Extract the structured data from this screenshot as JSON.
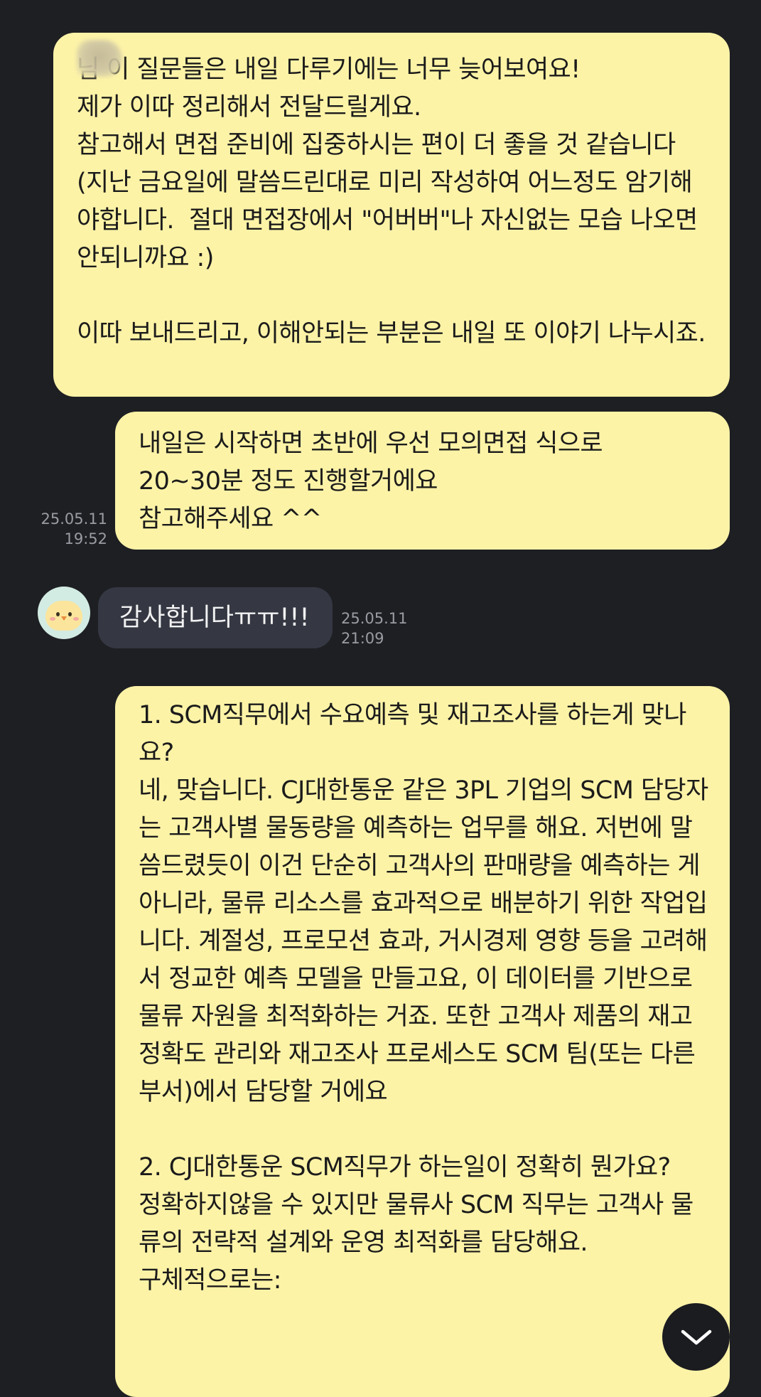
{
  "messages": [
    {
      "direction": "outgoing",
      "text": "님 이 질문들은 내일 다루기에는 너무 늦어보여요!\n제가 이따 정리해서 전달드릴게요.\n참고해서 면접 준비에 집중하시는 편이 더 좋을 것 같습니다 (지난 금요일에 말씀드린대로 미리 작성하여 어느정도 암기해야합니다.  절대 면접장에서 \"어버버\"나 자신없는 모습 나오면 안되니까요 :)\n\n이따 보내드리고, 이해안되는 부분은 내일 또 이야기 나누시죠."
    },
    {
      "direction": "outgoing",
      "text": "내일은 시작하면 초반에 우선 모의면접 식으로\n20~30분 정도 진행할거에요\n참고해주세요 ^^",
      "date": "25.05.11",
      "time": "19:52"
    },
    {
      "direction": "incoming",
      "text": "감사합니다ㅠㅠ!!!",
      "date": "25.05.11",
      "time": "21:09"
    },
    {
      "direction": "outgoing",
      "text": "1. SCM직무에서 수요예측 및 재고조사를 하는게 맞나요?\n네, 맞습니다. CJ대한통운 같은 3PL 기업의 SCM 담당자는 고객사별 물동량을 예측하는 업무를 해요. 저번에 말씀드렸듯이 이건 단순히 고객사의 판매량을 예측하는 게 아니라, 물류 리소스를 효과적으로 배분하기 위한 작업입니다. 계절성, 프로모션 효과, 거시경제 영향 등을 고려해서 정교한 예측 모델을 만들고요, 이 데이터를 기반으로 물류 자원을 최적화하는 거죠. 또한 고객사 제품의 재고 정확도 관리와 재고조사 프로세스도 SCM 팀(또는 다른 부서)에서 담당할 거에요\n\n2. CJ대한통운 SCM직무가 하는일이 정확히 뭔가요?\n정확하지않을 수 있지만 물류사 SCM 직무는 고객사 물류의 전략적 설계와 운영 최적화를 담당해요.\n구체적으로는:"
    }
  ],
  "icons": {
    "avatar": "chick-avatar",
    "scroll_down": "chevron-down-icon"
  },
  "colors": {
    "background": "#1e1f23",
    "outgoing_bubble": "#fdf3a7",
    "incoming_bubble": "#353843",
    "meta_text": "#9a9ca3"
  }
}
